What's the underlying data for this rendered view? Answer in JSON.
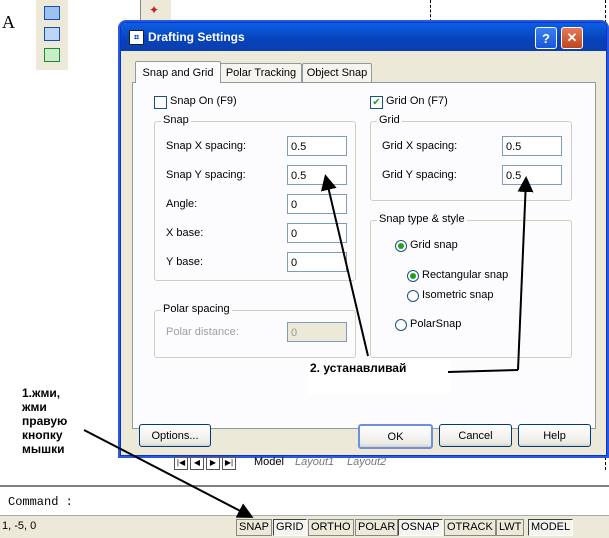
{
  "dialog": {
    "title": "Drafting Settings",
    "help_glyph": "?",
    "close_glyph": "✕",
    "tabs": [
      "Snap and Grid",
      "Polar Tracking",
      "Object Snap"
    ],
    "snap_on": {
      "label": "Snap On (F9)",
      "checked": false
    },
    "grid_on": {
      "label": "Grid On (F7)",
      "checked": true
    },
    "snap": {
      "group_label": "Snap",
      "x_label": "Snap X spacing:",
      "x_value": "0.5",
      "y_label": "Snap Y spacing:",
      "y_value": "0.5",
      "angle_label": "Angle:",
      "angle_value": "0",
      "xbase_label": "X base:",
      "xbase_value": "0",
      "ybase_label": "Y base:",
      "ybase_value": "0"
    },
    "grid": {
      "group_label": "Grid",
      "x_label": "Grid X spacing:",
      "x_value": "0.5",
      "y_label": "Grid Y spacing:",
      "y_value": "0.5"
    },
    "polar": {
      "group_label": "Polar spacing",
      "distance_label": "Polar distance:",
      "distance_value": "0"
    },
    "snap_type": {
      "group_label": "Snap type & style",
      "grid_snap": "Grid snap",
      "rectangular": "Rectangular snap",
      "isometric": "Isometric snap",
      "polar_snap": "PolarSnap"
    },
    "buttons": {
      "options": "Options...",
      "ok": "OK",
      "cancel": "Cancel",
      "help": "Help"
    }
  },
  "annotations": {
    "right_click": "1.жми, жми правую кнопку мышки",
    "set": "2. устанавливай"
  },
  "layout_tabs": [
    "Model",
    "Layout1",
    "Layout2"
  ],
  "command_prompt": "Command :",
  "coords": "1, -5, 0",
  "status_buttons": [
    "SNAP",
    "GRID",
    "ORTHO",
    "POLAR",
    "OSNAP",
    "OTRACK",
    "LWT",
    "MODEL"
  ],
  "background_letter": "A"
}
